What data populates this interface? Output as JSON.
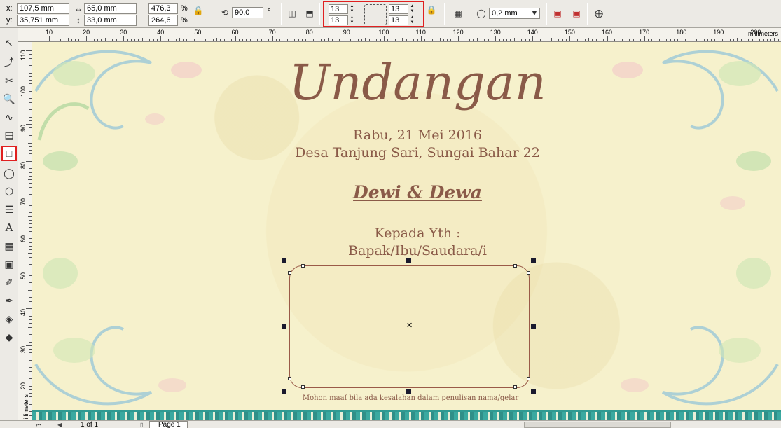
{
  "propbar": {
    "x_label": "x:",
    "x_value": "107,5 mm",
    "y_label": "y:",
    "y_value": "35,751 mm",
    "width_value": "65,0 mm",
    "height_value": "33,0 mm",
    "scale_x": "476,3",
    "scale_y": "264,6",
    "pct1": "%",
    "pct2": "%",
    "rotation": "90,0",
    "degree": "°",
    "corner_tl": "13",
    "corner_bl": "13",
    "corner_tr": "13",
    "corner_br": "13",
    "outline_width": "0,2 mm"
  },
  "ruler": {
    "h_numbers": [
      "10",
      "20",
      "30",
      "40",
      "50",
      "60",
      "70",
      "80",
      "90",
      "100",
      "110",
      "120",
      "130",
      "140",
      "150",
      "160",
      "170",
      "180",
      "190",
      "200"
    ],
    "v_numbers": [
      "110",
      "100",
      "90",
      "80",
      "70",
      "60",
      "50",
      "40",
      "30",
      "20"
    ],
    "unit_h": "millimeters",
    "unit_v": "millimeters"
  },
  "document": {
    "title": "Undangan",
    "date_line": "Rabu, 21 Mei 2016",
    "place_line": "Desa Tanjung Sari, Sungai Bahar 22",
    "names": "Dewi & Dewa",
    "kepada": "Kepada Yth :",
    "recipient": "Bapak/Ibu/Saudara/i",
    "footnote": "Mohon maaf bila ada kesalahan dalam penulisan nama/gelar"
  },
  "status": {
    "page_count": "1 of 1",
    "page_tab": "Page 1"
  },
  "colors": {
    "accent_text": "#8a5a48",
    "highlight": "#e02020",
    "paper": "#f6f1cc",
    "border_teal": "#2f9a92"
  },
  "icons": [
    "pick-tool-icon",
    "shape-tool-icon",
    "crop-tool-icon",
    "zoom-tool-icon",
    "freehand-tool-icon",
    "smart-fill-icon",
    "rectangle-tool-icon",
    "ellipse-tool-icon",
    "polygon-tool-icon",
    "basic-shapes-icon",
    "text-tool-icon",
    "table-tool-icon",
    "blend-tool-icon",
    "eyedropper-icon",
    "outline-pen-icon",
    "fill-tool-icon",
    "interactive-fill-icon"
  ]
}
